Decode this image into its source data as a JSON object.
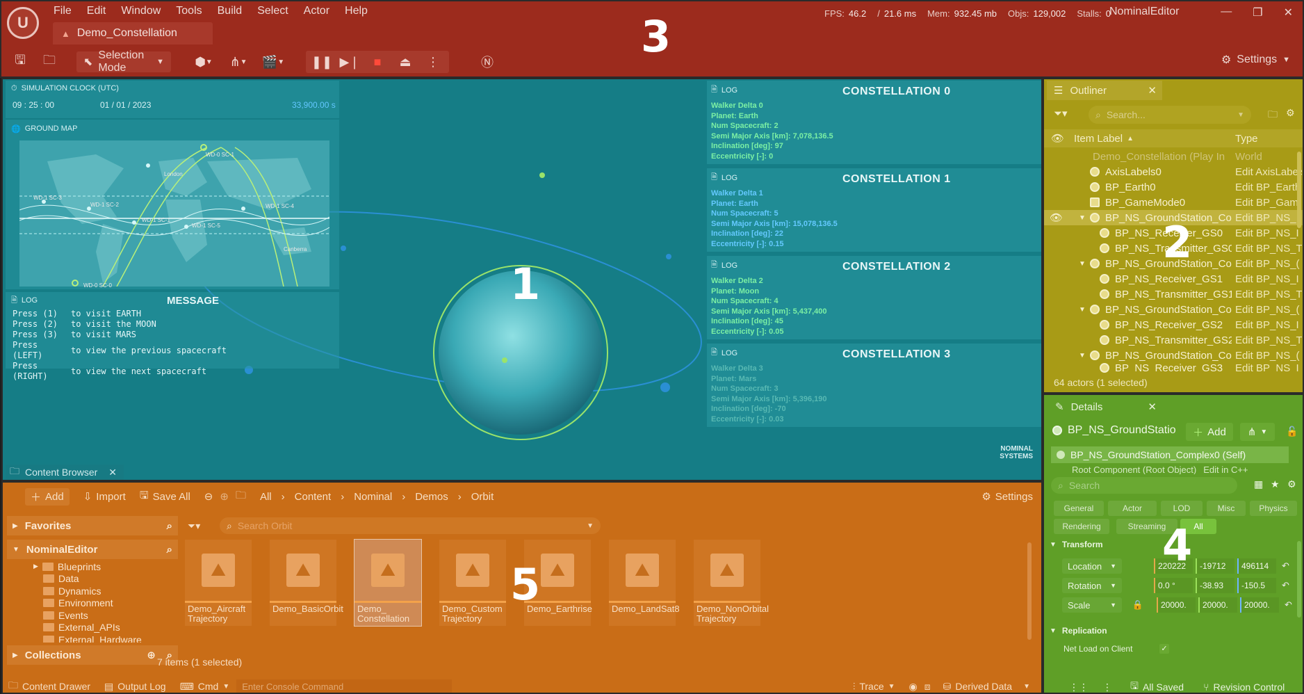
{
  "app": {
    "logo_letter": "U",
    "menus": [
      "File",
      "Edit",
      "Window",
      "Tools",
      "Build",
      "Select",
      "Actor",
      "Help"
    ],
    "document_tab": "Demo_Constellation",
    "stats": [
      {
        "label": "FPS:",
        "value": "46.2"
      },
      {
        "label": "/",
        "value": "21.6 ms"
      },
      {
        "label": "Mem:",
        "value": "932.45 mb"
      },
      {
        "label": "Objs:",
        "value": "129,002"
      },
      {
        "label": "Stalls:",
        "value": "0"
      }
    ],
    "editor_name": "NominalEditor",
    "toolbar": {
      "selection_mode": "Selection Mode",
      "settings": "Settings"
    },
    "region_labels": {
      "viewport": "1",
      "outliner": "2",
      "toolbar": "3",
      "details": "4",
      "content": "5"
    }
  },
  "viewport": {
    "clock": {
      "title": "SIMULATION CLOCK (UTC)",
      "time": "09 : 25 : 00",
      "date": "01 / 01 / 2023",
      "seconds": "33,900.00 s"
    },
    "ground_map": {
      "title": "GROUND MAP",
      "labels": [
        "WD-0 SC-1",
        "WD-1 SC-3",
        "WD-1 SC-2",
        "WD-1 SC-1",
        "WD-1 SC-5",
        "WD-1 SC-4",
        "London",
        "Canberra",
        "WD-0 SC-0"
      ]
    },
    "message": {
      "log": "LOG",
      "title": "MESSAGE",
      "lines": [
        {
          "key": "Press (1)",
          "text": "to visit EARTH"
        },
        {
          "key": "Press (2)",
          "text": "to visit the MOON"
        },
        {
          "key": "Press (3)",
          "text": "to visit MARS"
        },
        {
          "key": "Press (LEFT)",
          "text": "to view the previous spacecraft"
        },
        {
          "key": "Press (RIGHT)",
          "text": "to view the next spacecraft"
        }
      ]
    },
    "constellations": [
      {
        "log": "LOG",
        "title": "CONSTELLATION 0",
        "walker": "Walker Delta 0",
        "planet": "Planet: Earth",
        "num": "Num Spacecraft: 2",
        "sma": "Semi Major Axis [km]: 7,078,136.5",
        "inc": "Inclination [deg]: 97",
        "ecc": "Eccentricity [-]: 0"
      },
      {
        "log": "LOG",
        "title": "CONSTELLATION 1",
        "walker": "Walker Delta 1",
        "planet": "Planet: Earth",
        "num": "Num Spacecraft: 5",
        "sma": "Semi Major Axis [km]: 15,078,136.5",
        "inc": "Inclination [deg]: 22",
        "ecc": "Eccentricity [-]: 0.15"
      },
      {
        "log": "LOG",
        "title": "CONSTELLATION 2",
        "walker": "Walker Delta 2",
        "planet": "Planet: Moon",
        "num": "Num Spacecraft: 4",
        "sma": "Semi Major Axis [km]: 5,437,400",
        "inc": "Inclination [deg]: 45",
        "ecc": "Eccentricity [-]: 0.05"
      },
      {
        "log": "LOG",
        "title": "CONSTELLATION 3",
        "walker": "Walker Delta 3",
        "planet": "Planet: Mars",
        "num": "Num Spacecraft: 3",
        "sma": "Semi Major Axis [km]: 5,396,190",
        "inc": "Inclination [deg]: -70",
        "ecc": "Eccentricity [-]: 0.03"
      }
    ],
    "brand": {
      "line1": "NOMINAL",
      "line2": "SYSTEMS"
    },
    "content_browser_tab": "Content Browser"
  },
  "outliner": {
    "tab": "Outliner",
    "search_placeholder": "Search...",
    "col_label": "Item Label",
    "col_type": "Type",
    "rows": [
      {
        "label": "Demo_Constellation (Play In",
        "type": "World"
      },
      {
        "label": "AxisLabels0",
        "type": "Edit AxisLabels"
      },
      {
        "label": "BP_Earth0",
        "type": "Edit BP_Earth"
      },
      {
        "label": "BP_GameMode0",
        "type": "Edit BP_Gam"
      },
      {
        "label": "BP_NS_GroundStation_Cor",
        "type": "Edit BP_NS_"
      },
      {
        "label": "BP_NS_Receiver_GS0",
        "type": "Edit BP_NS_I"
      },
      {
        "label": "BP_NS_Transmitter_GS0",
        "type": "Edit BP_NS_T"
      },
      {
        "label": "BP_NS_GroundStation_Cor",
        "type": "Edit BP_NS_("
      },
      {
        "label": "BP_NS_Receiver_GS1",
        "type": "Edit BP_NS_I"
      },
      {
        "label": "BP_NS_Transmitter_GS1",
        "type": "Edit BP_NS_T"
      },
      {
        "label": "BP_NS_GroundStation_Cor",
        "type": "Edit BP_NS_("
      },
      {
        "label": "BP_NS_Receiver_GS2",
        "type": "Edit BP_NS_I"
      },
      {
        "label": "BP_NS_Transmitter_GS2",
        "type": "Edit BP_NS_T"
      },
      {
        "label": "BP_NS_GroundStation_Cor",
        "type": "Edit BP_NS_("
      },
      {
        "label": "BP_NS_Receiver_GS3",
        "type": "Edit BP_NS_I"
      }
    ],
    "footer": "64 actors (1 selected)"
  },
  "details": {
    "tab": "Details",
    "actor_name": "BP_NS_GroundStatio",
    "add_label": "Add",
    "self_component": "BP_NS_GroundStation_Complex0 (Self)",
    "root_component": "Root Component (Root Object)",
    "root_edit": "Edit in C++",
    "search_placeholder": "Search",
    "filters": [
      "General",
      "Actor",
      "LOD",
      "Misc",
      "Physics",
      "Rendering",
      "Streaming",
      "All"
    ],
    "transform": {
      "title": "Transform",
      "location": {
        "label": "Location",
        "x": "220222",
        "y": "-19712",
        "z": "496114"
      },
      "rotation": {
        "label": "Rotation",
        "x": "0.0 °",
        "y": "-38.93",
        "z": "-150.5"
      },
      "scale": {
        "label": "Scale",
        "x": "20000.",
        "y": "20000.",
        "z": "20000."
      }
    },
    "replication": {
      "title": "Replication",
      "net_load": "Net Load on Client"
    },
    "status": {
      "saved": "All Saved",
      "revision": "Revision Control"
    }
  },
  "content_browser": {
    "add": "Add",
    "import": "Import",
    "save_all": "Save All",
    "breadcrumb": [
      "All",
      "Content",
      "Nominal",
      "Demos",
      "Orbit"
    ],
    "settings": "Settings",
    "favorites": "Favorites",
    "root": "NominalEditor",
    "search_placeholder": "Search Orbit",
    "folders": [
      "Blueprints",
      "Data",
      "Dynamics",
      "Environment",
      "Events",
      "External_APIs",
      "External_Hardware"
    ],
    "collections": "Collections",
    "assets": [
      {
        "l1": "Demo_Aircraft",
        "l2": "Trajectory"
      },
      {
        "l1": "Demo_BasicOrbit",
        "l2": ""
      },
      {
        "l1": "Demo_",
        "l2": "Constellation"
      },
      {
        "l1": "Demo_Custom",
        "l2": "Trajectory"
      },
      {
        "l1": "Demo_Earthrise",
        "l2": ""
      },
      {
        "l1": "Demo_LandSat8",
        "l2": ""
      },
      {
        "l1": "Demo_NonOrbital",
        "l2": "Trajectory"
      }
    ],
    "count": "7 items (1 selected)",
    "status": {
      "drawer": "Content Drawer",
      "output": "Output Log",
      "cmd": "Cmd",
      "console_placeholder": "Enter Console Command",
      "trace": "Trace",
      "derived": "Derived Data"
    }
  }
}
